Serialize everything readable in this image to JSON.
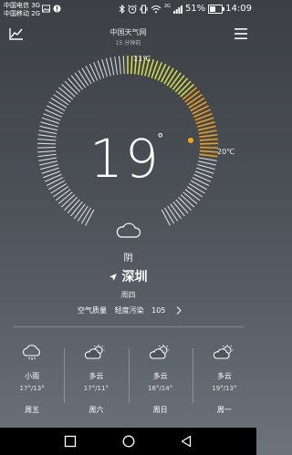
{
  "status_bar": {
    "carrier1": "中国电信 3G",
    "carrier2": "中国移动 2G",
    "network": "2G",
    "battery": "51%",
    "battery_level": 0.51,
    "time": "14:09"
  },
  "header": {
    "source": "中国天气网",
    "updated": "15 分钟前"
  },
  "current": {
    "temp": "19",
    "degree": "°",
    "high": "11℃",
    "low": "20℃",
    "condition": "阴",
    "city": "深圳",
    "weekday": "周四",
    "aqi_label": "空气质量",
    "aqi_level": "轻度污染",
    "aqi_value": "105"
  },
  "forecast": [
    {
      "condition": "小雨",
      "temp": "17°/13°",
      "day": "周五",
      "icon": "rain-cloud-icon"
    },
    {
      "condition": "多云",
      "temp": "17°/11°",
      "day": "周六",
      "icon": "partly-cloudy-icon"
    },
    {
      "condition": "多云",
      "temp": "18°/14°",
      "day": "周日",
      "icon": "partly-cloudy-icon"
    },
    {
      "condition": "多云",
      "temp": "19°/13°",
      "day": "周一",
      "icon": "partly-cloudy-icon"
    }
  ],
  "colors": {
    "accent_orange": "#f4a21a",
    "accent_yellow": "#d8e04a",
    "tick_white": "#ffffff"
  }
}
